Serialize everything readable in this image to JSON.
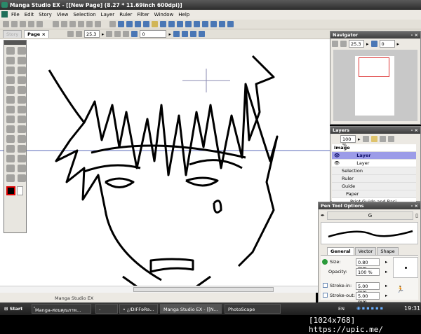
{
  "window": {
    "title": "Manga Studio EX - [[New Page] (8.27 * 11.69inch 600dpi)]"
  },
  "menu": [
    "File",
    "Edit",
    "Story",
    "View",
    "Selection",
    "Layer",
    "Ruler",
    "Filter",
    "Window",
    "Help"
  ],
  "toolbar2": {
    "story_tab": "Story",
    "page_tab": "Page",
    "close": "×",
    "zoom": "25.3",
    "rotation": "0"
  },
  "status": "Manga Studio EX",
  "navigator": {
    "title": "Navigator",
    "zoom": "25.3",
    "rotation": "0"
  },
  "layers": {
    "title": "Layers",
    "opacity": "100 %",
    "group": "Image",
    "items": [
      {
        "name": "Layer",
        "selected": true
      },
      {
        "name": "Layer",
        "selected": false
      }
    ],
    "special": [
      "Selection",
      "Ruler",
      "Guide",
      "Paper"
    ],
    "guide_layer": "Print Guide and Basi..."
  },
  "pen": {
    "title": "Pen Tool Options",
    "preset": "G",
    "tabs": [
      "General",
      "Vector",
      "Shape"
    ],
    "size_label": "Size:",
    "size": "0.80 mm",
    "opacity_label": "Opacity:",
    "opacity": "100 %",
    "stroke_in_label": "Stroke-in:",
    "stroke_in": "5.00 mm",
    "stroke_out_label": "Stroke-out:",
    "stroke_out": "5.00 mm"
  },
  "taskbar": {
    "start": "Start",
    "tasks": [
      "์Manga-สอนคุณภาพ...",
      "-",
      "• ¿/DIFFəRə...",
      "Manga Studio EX - [[N...",
      "PhotoScape"
    ],
    "lang": "EN",
    "clock": "19:31"
  },
  "footer": "[1024x768] https://upic.me/"
}
